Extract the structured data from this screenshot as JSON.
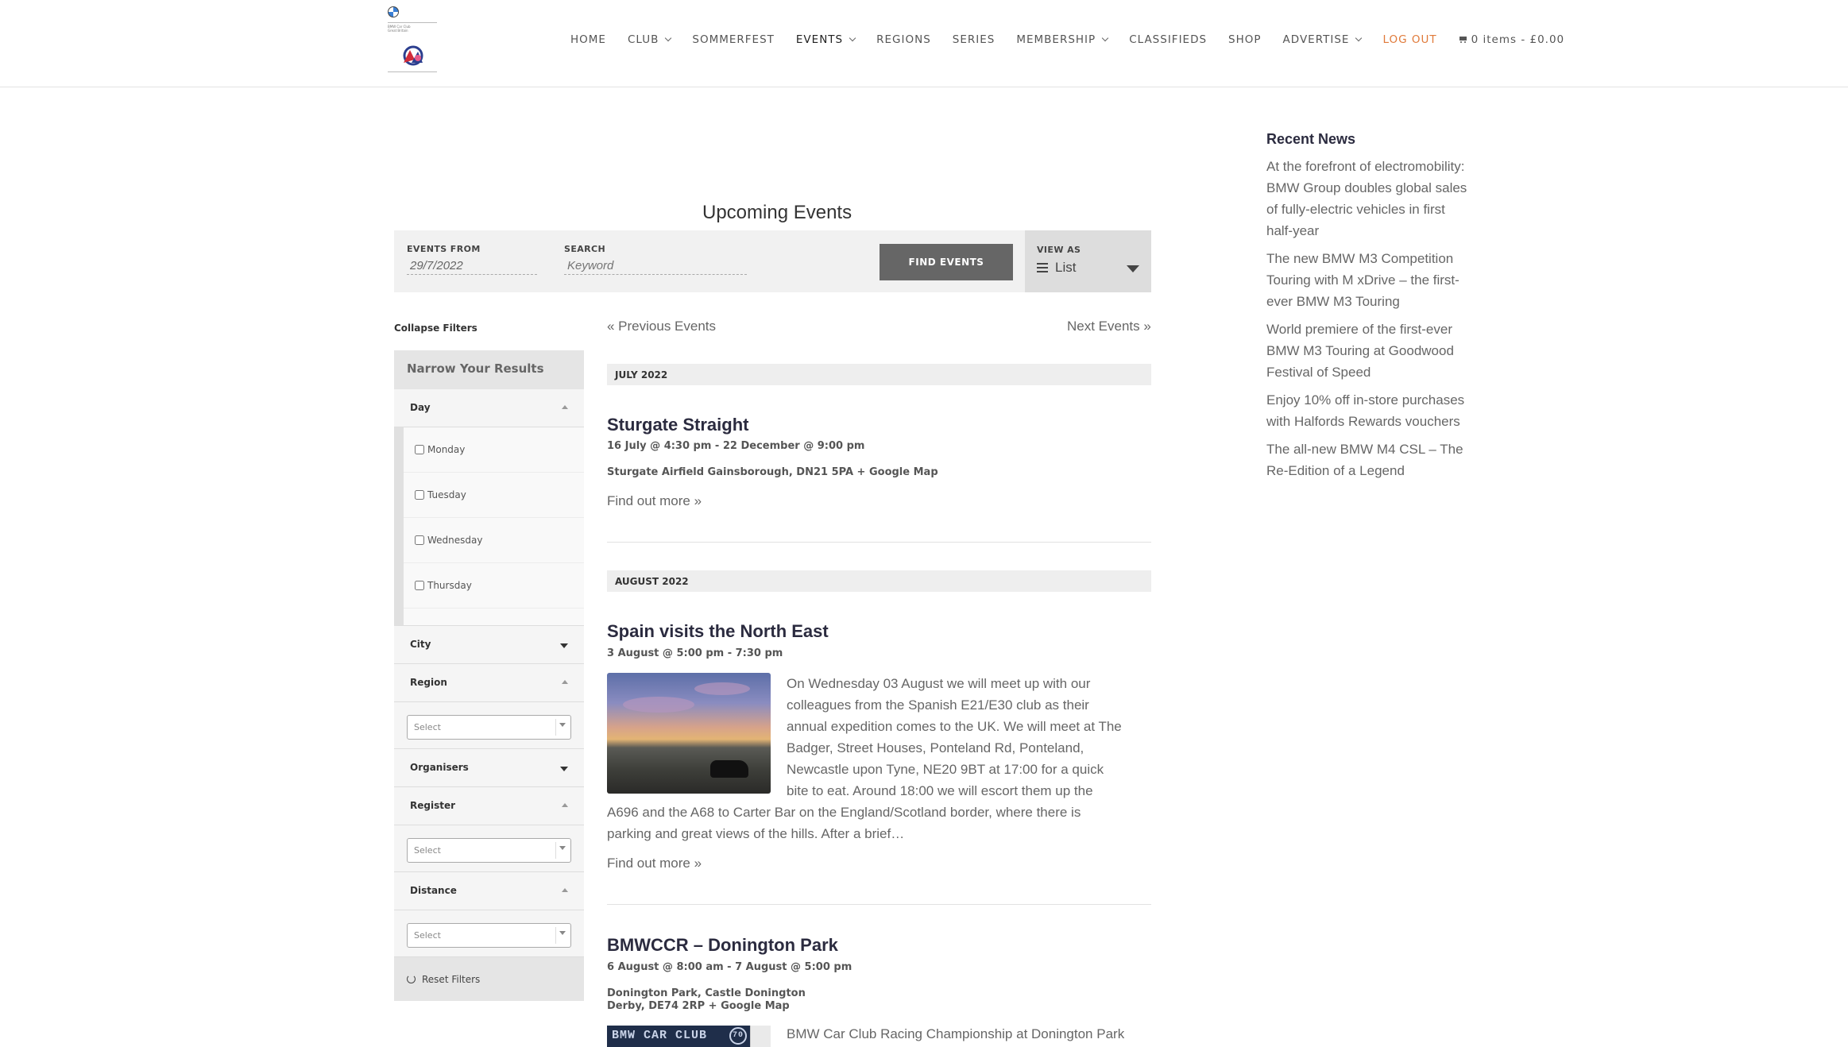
{
  "logo": {
    "tiny_line1": "BMW Car Club",
    "tiny_line2": "Great Britain"
  },
  "nav": {
    "items": [
      {
        "label": "HOME",
        "dropdown": false
      },
      {
        "label": "CLUB",
        "dropdown": true
      },
      {
        "label": "SOMMERFEST",
        "dropdown": false
      },
      {
        "label": "EVENTS",
        "dropdown": true
      },
      {
        "label": "REGIONS",
        "dropdown": false
      },
      {
        "label": "SERIES",
        "dropdown": false
      },
      {
        "label": "MEMBERSHIP",
        "dropdown": true
      },
      {
        "label": "CLASSIFIEDS",
        "dropdown": false
      },
      {
        "label": "SHOP",
        "dropdown": false
      },
      {
        "label": "ADVERTISE",
        "dropdown": true
      },
      {
        "label": "LOG OUT",
        "dropdown": false
      }
    ],
    "cart": "0 items - £0.00",
    "active": "EVENTS"
  },
  "main": {
    "title": "Upcoming Events",
    "events_from_label": "EVENTS FROM",
    "events_from_value": "29/7/2022",
    "search_label": "SEARCH",
    "search_placeholder": "Keyword",
    "find_button": "FIND EVENTS",
    "view_as_label": "VIEW AS",
    "view_as_value": "List",
    "prev": "« Previous Events",
    "next": "Next Events »"
  },
  "filters": {
    "collapse": "Collapse Filters",
    "heading": "Narrow Your Results",
    "day_label": "Day",
    "days": [
      "Monday",
      "Tuesday",
      "Wednesday",
      "Thursday"
    ],
    "city_label": "City",
    "region_label": "Region",
    "organisers_label": "Organisers",
    "register_label": "Register",
    "distance_label": "Distance",
    "select_placeholder": "Select",
    "reset": "Reset Filters"
  },
  "events": {
    "month1": "JULY 2022",
    "e1_title": "Sturgate Straight",
    "e1_date": "16 July @ 4:30 pm - 22 December @ 9:00 pm",
    "e1_venue": "Sturgate Airfield Gainsborough, DN21 5PA + Google Map",
    "find_more": "Find out more »",
    "month2": "AUGUST 2022",
    "e2_title": "Spain visits the North East",
    "e2_date": "3 August @ 5:00 pm - 7:30 pm",
    "e2_desc": "On Wednesday 03 August we will meet up with our colleagues from the Spanish E21/E30 club as their annual expedition comes to the UK. We will meet at The Badger, Street Houses, Ponteland Rd, Ponteland, Newcastle upon Tyne, NE20 9BT at 17:00 for a quick bite to eat. Around 18:00 we will escort them up the A696 and the A68 to Carter Bar on the England/Scotland border, where there is parking and great views of the hills. After a brief…",
    "e3_title": "BMWCCR – Donington Park",
    "e3_date": "6 August @ 8:00 am - 7 August @ 5:00 pm",
    "e3_venue1": "Donington Park, Castle Donington",
    "e3_venue2": "Derby, DE74 2RP + Google Map",
    "e3_thumb_text": "BMW CAR CLUB",
    "e3_thumb_badge": "70",
    "e3_desc": "BMW Car Club Racing Championship at Donington Park"
  },
  "news": {
    "heading": "Recent News",
    "items": [
      "At the forefront of electromobility: BMW Group doubles global sales of fully-electric vehicles in first half-year",
      "The new BMW M3 Competition Touring with M xDrive – the first-ever BMW M3 Touring",
      "World premiere of the first-ever BMW M3 Touring at Goodwood Festival of Speed",
      "Enjoy 10% off in-store purchases with Halfords Rewards vouchers",
      "The all-new BMW M4 CSL – The Re-Edition of a Legend"
    ]
  }
}
